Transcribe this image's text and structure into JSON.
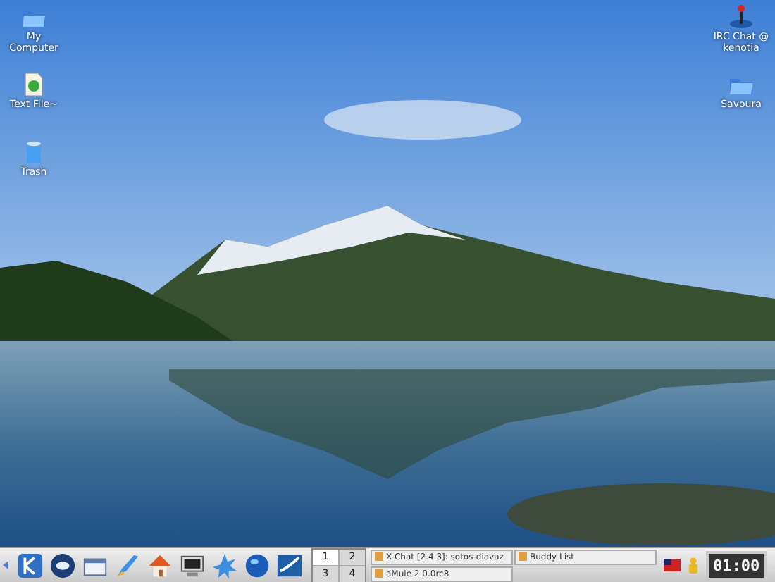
{
  "left_icons": [
    {
      "label": "My Computer",
      "kind": "folder"
    },
    {
      "label": "Text File~",
      "kind": "document"
    },
    {
      "label": "Trash",
      "kind": "trash"
    }
  ],
  "right_icons": [
    {
      "label": "IRC Chat @ kenotia",
      "kind": "joystick"
    },
    {
      "label": "Savoura",
      "kind": "folder"
    }
  ],
  "taskbar": {
    "pager": [
      {
        "label": "1",
        "selected": true
      },
      {
        "label": "2",
        "selected": false
      },
      {
        "label": "3",
        "selected": false
      },
      {
        "label": "4",
        "selected": false
      }
    ],
    "tasks": [
      {
        "title": "X-Chat [2.4.3]: sotos-diavaz"
      },
      {
        "title": "Buddy List"
      },
      {
        "title": "aMule 2.0.0rc8"
      }
    ],
    "clock": "01:00"
  }
}
